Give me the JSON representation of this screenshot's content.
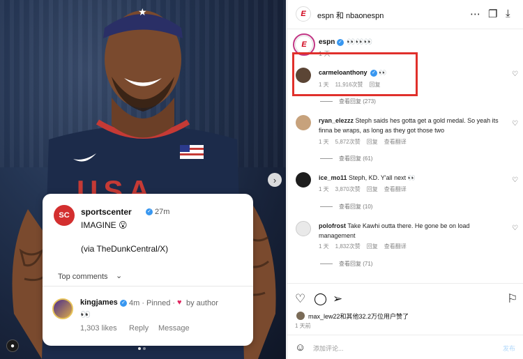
{
  "photo": {
    "jersey_text": "USA",
    "nav_arrow": "›"
  },
  "card": {
    "avatar_text": "SC",
    "name": "sportscenter",
    "time": "27m",
    "line1": "IMAGINE 😮",
    "line2": "(via TheDunkCentral/X)",
    "top_comments_label": "Top comments",
    "comment": {
      "name": "kingjames",
      "meta": "4m · Pinned ·",
      "by": "by author",
      "text": "👀",
      "likes": "1,303 likes",
      "reply": "Reply",
      "message": "Message"
    }
  },
  "header": {
    "title": "espn 和 nbaonespn",
    "icons": [
      "more-icon",
      "copy-icon",
      "download-icon"
    ]
  },
  "caption": {
    "avatar_text": "E",
    "name": "espn",
    "text": "👀👀👀",
    "time": "1 天"
  },
  "comments": [
    {
      "name": "carmeloanthony",
      "text": "👀",
      "meta": [
        "1 天",
        "11,916次赞",
        "回复"
      ],
      "view": "查看回复 (273)"
    },
    {
      "name": "ryan_elezzz",
      "text": "Steph saids hes gotta get a gold medal. So yeah its finna be wraps, as long as they got those two",
      "meta": [
        "1 天",
        "5,872次赞",
        "回复",
        "查看翻译"
      ],
      "view": "查看回复 (61)"
    },
    {
      "name": "ice_mo11",
      "text": "Steph, KD. Y'all next 👀",
      "meta": [
        "1 天",
        "3,870次赞",
        "回复",
        "查看翻译"
      ],
      "view": "查看回复 (10)"
    },
    {
      "name": "polofrost",
      "text": "Take Kawhi outta there. He gone be on load management",
      "meta": [
        "1 天",
        "1,832次赞",
        "回复",
        "查看翻译"
      ],
      "view": "查看回复 (71)"
    }
  ],
  "actions": {
    "liked_by": "max_lew22和其他32.2万位用户赞了",
    "time": "1 天前",
    "add_comment_placeholder": "添加评论...",
    "post_label": "发布"
  },
  "colors": {
    "highlight": "#e0302b",
    "verified": "#3897f0",
    "espn_red": "#d0021b"
  }
}
